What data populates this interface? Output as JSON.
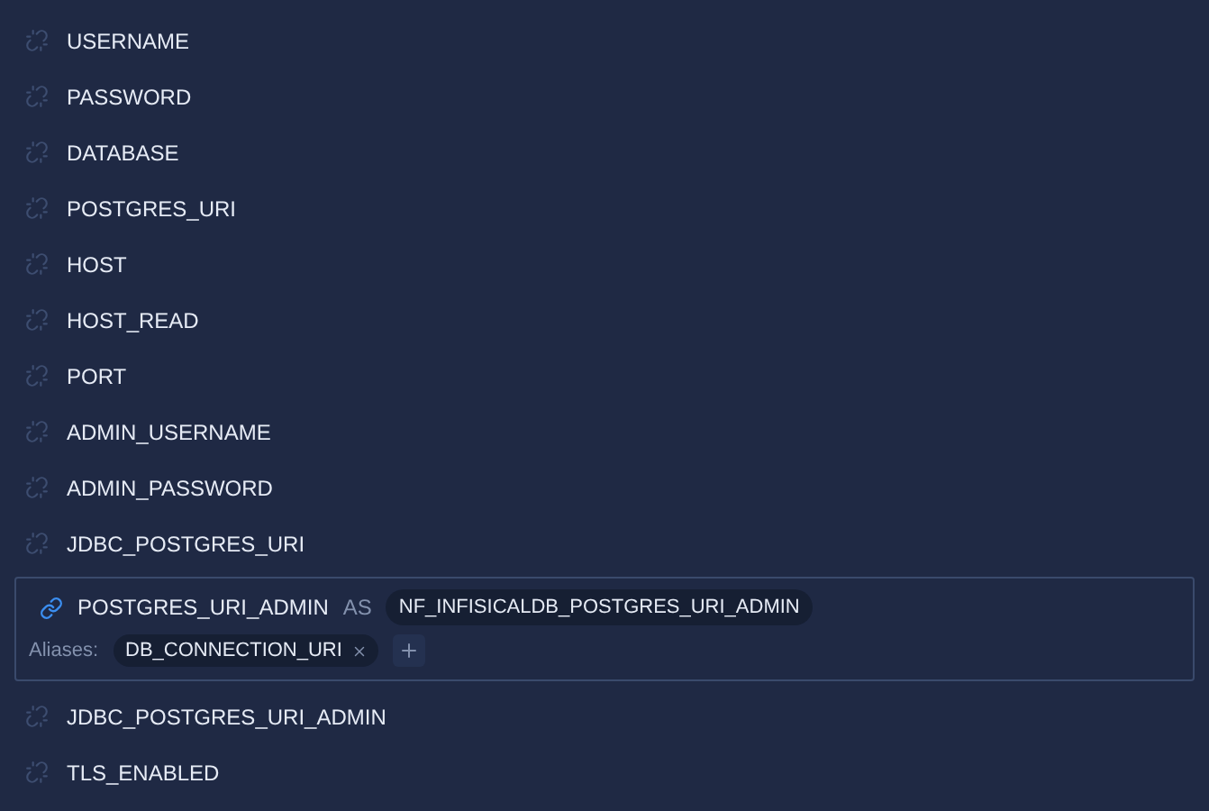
{
  "secrets": [
    {
      "name": "USERNAME",
      "linked": false
    },
    {
      "name": "PASSWORD",
      "linked": false
    },
    {
      "name": "DATABASE",
      "linked": false
    },
    {
      "name": "POSTGRES_URI",
      "linked": false
    },
    {
      "name": "HOST",
      "linked": false
    },
    {
      "name": "HOST_READ",
      "linked": false
    },
    {
      "name": "PORT",
      "linked": false
    },
    {
      "name": "ADMIN_USERNAME",
      "linked": false
    },
    {
      "name": "ADMIN_PASSWORD",
      "linked": false
    },
    {
      "name": "JDBC_POSTGRES_URI",
      "linked": false
    },
    {
      "name": "POSTGRES_URI_ADMIN",
      "linked": true,
      "as_label": "AS",
      "target": "NF_INFISICALDB_POSTGRES_URI_ADMIN",
      "aliases_label": "Aliases:",
      "aliases": [
        "DB_CONNECTION_URI"
      ]
    },
    {
      "name": "JDBC_POSTGRES_URI_ADMIN",
      "linked": false
    },
    {
      "name": "TLS_ENABLED",
      "linked": false
    }
  ]
}
